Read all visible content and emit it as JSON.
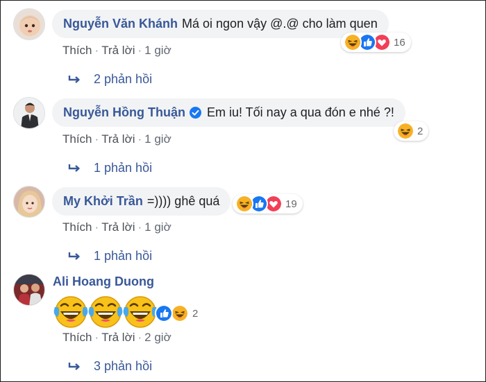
{
  "comments": [
    {
      "author": "Nguyễn Văn Khánh",
      "text": "Má oi ngon vậy @.@ cho làm quen",
      "like_label": "Thích",
      "reply_label": "Trả lời",
      "time": "1 giờ",
      "reaction_count": "16",
      "reactions": [
        "haha-icon",
        "like-icon",
        "love-icon"
      ],
      "replies_label": "2 phản hồi"
    },
    {
      "author": "Nguyễn Hồng Thuận",
      "verified": true,
      "text": "Em iu! Tối nay a qua đón e nhé ?!",
      "like_label": "Thích",
      "reply_label": "Trả lời",
      "time": "1 giờ",
      "reaction_count": "2",
      "reactions": [
        "haha-icon"
      ],
      "replies_label": "1 phản hồi"
    },
    {
      "author": "My Khởi Trần",
      "text": "=)))) ghê quá",
      "like_label": "Thích",
      "reply_label": "Trả lời",
      "time": "1 giờ",
      "reaction_count": "19",
      "reactions": [
        "haha-icon",
        "like-icon",
        "love-icon"
      ],
      "replies_label": "1 phản hồi"
    },
    {
      "author": "Ali Hoang Duong",
      "stickers": [
        "laughing-crying-sticker",
        "laughing-crying-sticker",
        "laughing-crying-sticker"
      ],
      "like_label": "Thích",
      "reply_label": "Trả lời",
      "time": "2 giờ",
      "reaction_count": "2",
      "reactions": [
        "like-icon",
        "haha-icon"
      ],
      "replies_label": "3 phản hồi"
    }
  ],
  "colors": {
    "name_link": "#385898",
    "bubble_bg": "#f2f3f5",
    "like_blue": "#1877f2",
    "love_red": "#f33e58",
    "haha_yellow": "#f7b125"
  }
}
